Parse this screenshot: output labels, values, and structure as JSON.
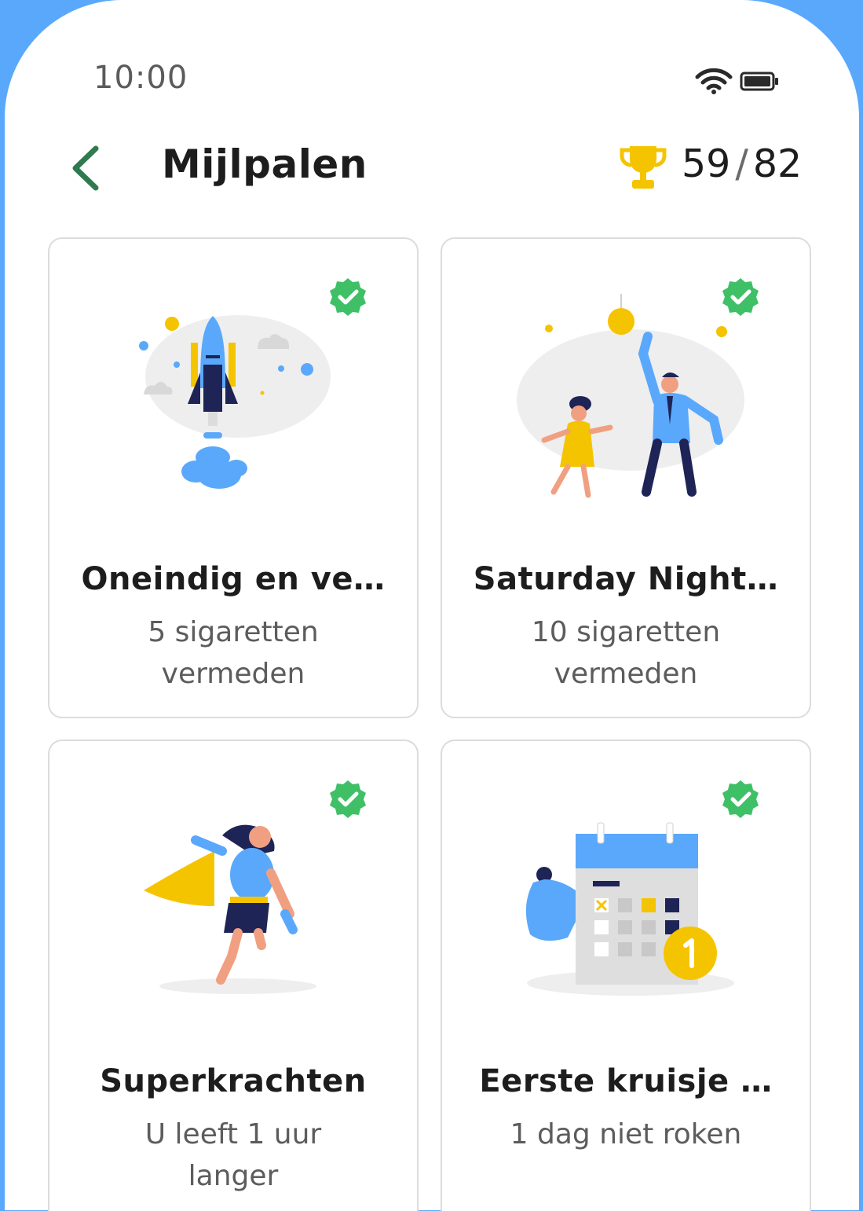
{
  "status_bar": {
    "time": "10:00",
    "icons": [
      "wifi-icon",
      "battery-icon"
    ]
  },
  "header": {
    "title": "Mijlpalen",
    "score_current": "59",
    "score_separator": "/",
    "score_total": "82",
    "trophy_color": "#f5c400"
  },
  "colors": {
    "accent_green": "#2f7a4f",
    "check_green": "#3fc067",
    "frame_blue": "#5aa8fb"
  },
  "milestones": [
    {
      "title": "Oneindig en ve…",
      "subtitle": "5 sigaretten vermeden",
      "completed": true,
      "illustration": "rocket-illustration"
    },
    {
      "title": "Saturday Night…",
      "subtitle": "10 sigaretten vermeden",
      "completed": true,
      "illustration": "dancing-couple-illustration"
    },
    {
      "title": "Superkrachten",
      "subtitle": "U leeft 1 uur langer",
      "completed": true,
      "illustration": "superhero-illustration"
    },
    {
      "title": "Eerste kruisje …",
      "subtitle": "1 dag niet roken",
      "completed": true,
      "illustration": "calendar-illustration"
    }
  ]
}
